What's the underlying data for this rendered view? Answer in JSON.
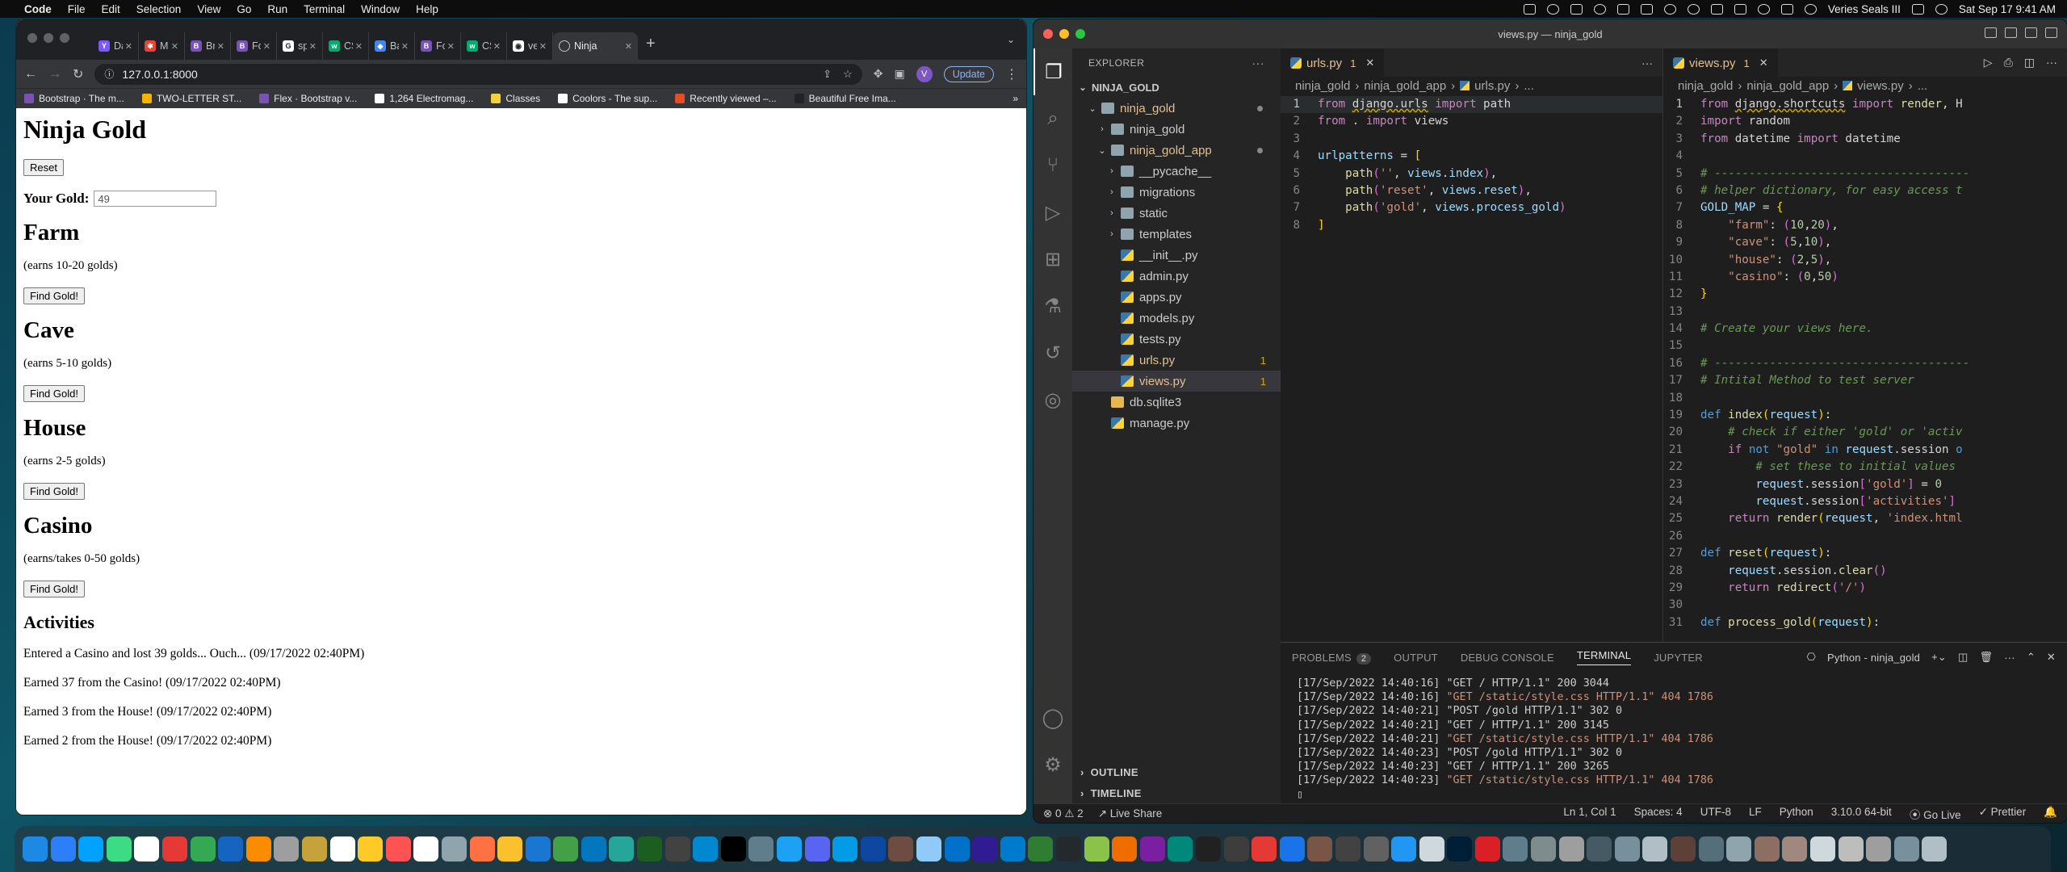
{
  "menubar": {
    "app": "Code",
    "items": [
      "File",
      "Edit",
      "Selection",
      "View",
      "Go",
      "Run",
      "Terminal",
      "Window",
      "Help"
    ],
    "user": "Veries Seals III",
    "clock": "Sat Sep 17  9:41 AM"
  },
  "browser": {
    "tabs": [
      {
        "label": "Day",
        "color": "#7a5af8",
        "glyph": "Y"
      },
      {
        "label": "Mag",
        "color": "#ea4335",
        "glyph": "✱"
      },
      {
        "label": "Brea",
        "color": "#7952b3",
        "glyph": "B"
      },
      {
        "label": "Form",
        "color": "#7952b3",
        "glyph": "B"
      },
      {
        "label": "spar",
        "color": "#ffffff",
        "glyph": "G"
      },
      {
        "label": "CSS",
        "color": "#04aa6d",
        "glyph": "w"
      },
      {
        "label": "Barl",
        "color": "#4285f4",
        "glyph": "◆"
      },
      {
        "label": "Form",
        "color": "#7952b3",
        "glyph": "B"
      },
      {
        "label": "CSS",
        "color": "#04aa6d",
        "glyph": "w"
      },
      {
        "label": "verie",
        "color": "#ffffff",
        "glyph": "◉"
      }
    ],
    "active_tab": "Ninja",
    "url": "127.0.0.1:8000",
    "update_label": "Update",
    "avatar_letter": "V",
    "bookmarks": [
      {
        "label": "Bootstrap · The m...",
        "color": "#7952b3"
      },
      {
        "label": "TWO-LETTER ST...",
        "color": "#f4b400"
      },
      {
        "label": "Flex · Bootstrap v...",
        "color": "#7952b3"
      },
      {
        "label": "1,264 Electromag...",
        "color": "#ffffff"
      },
      {
        "label": "Classes",
        "color": "#f4d03f"
      },
      {
        "label": "Coolors - The sup...",
        "color": "#ffffff"
      },
      {
        "label": "Recently viewed –...",
        "color": "#e44d26"
      },
      {
        "label": "Beautiful Free Ima...",
        "color": "#222222"
      }
    ],
    "more_bookmarks": "»"
  },
  "page": {
    "title": "Ninja Gold",
    "reset_label": "Reset",
    "gold_label": "Your Gold:",
    "gold_value": "49",
    "locations": [
      {
        "name": "Farm",
        "desc": "(earns 10-20 golds)",
        "button": "Find Gold!"
      },
      {
        "name": "Cave",
        "desc": "(earns 5-10 golds)",
        "button": "Find Gold!"
      },
      {
        "name": "House",
        "desc": "(earns 2-5 golds)",
        "button": "Find Gold!"
      },
      {
        "name": "Casino",
        "desc": "(earns/takes 0-50 golds)",
        "button": "Find Gold!"
      }
    ],
    "activities_title": "Activities",
    "activities": [
      "Entered a Casino and lost 39 golds... Ouch... (09/17/2022 02:40PM)",
      "Earned 37 from the Casino! (09/17/2022 02:40PM)",
      "Earned 3 from the House! (09/17/2022 02:40PM)",
      "Earned 2 from the House! (09/17/2022 02:40PM)"
    ]
  },
  "vscode": {
    "title": "views.py — ninja_gold",
    "explorer_title": "EXPLORER",
    "root": "NINJA_GOLD",
    "tree": [
      {
        "label": "ninja_gold",
        "type": "folder",
        "open": true,
        "depth": 1,
        "yellow": true,
        "dot": true
      },
      {
        "label": "ninja_gold",
        "type": "folder",
        "open": false,
        "depth": 2
      },
      {
        "label": "ninja_gold_app",
        "type": "folder",
        "open": true,
        "depth": 2,
        "yellow": true,
        "dot": true
      },
      {
        "label": "__pycache__",
        "type": "folder",
        "open": false,
        "depth": 3
      },
      {
        "label": "migrations",
        "type": "folder",
        "open": false,
        "depth": 3
      },
      {
        "label": "static",
        "type": "folder",
        "open": false,
        "depth": 3
      },
      {
        "label": "templates",
        "type": "folder",
        "open": false,
        "depth": 3
      },
      {
        "label": "__init__.py",
        "type": "py",
        "depth": 3
      },
      {
        "label": "admin.py",
        "type": "py",
        "depth": 3
      },
      {
        "label": "apps.py",
        "type": "py",
        "depth": 3
      },
      {
        "label": "models.py",
        "type": "py",
        "depth": 3
      },
      {
        "label": "tests.py",
        "type": "py",
        "depth": 3
      },
      {
        "label": "urls.py",
        "type": "py",
        "depth": 3,
        "yellow": true,
        "badge": "1"
      },
      {
        "label": "views.py",
        "type": "py",
        "depth": 3,
        "yellow": true,
        "badge": "1",
        "selected": true
      },
      {
        "label": "db.sqlite3",
        "type": "db",
        "depth": 2
      },
      {
        "label": "manage.py",
        "type": "py",
        "depth": 2
      }
    ],
    "outline": "OUTLINE",
    "timeline": "TIMELINE",
    "left_tab": {
      "name": "urls.py",
      "count": "1"
    },
    "right_tab": {
      "name": "views.py",
      "count": "1"
    },
    "left_crumbs": [
      "ninja_gold",
      "ninja_gold_app",
      "urls.py",
      "..."
    ],
    "right_crumbs": [
      "ninja_gold",
      "ninja_gold_app",
      "views.py",
      "..."
    ],
    "panel_tabs": [
      "PROBLEMS",
      "OUTPUT",
      "DEBUG CONSOLE",
      "TERMINAL",
      "JUPYTER"
    ],
    "problems_count": "2",
    "terminal_name": "Python - ninja_gold",
    "terminal_lines": [
      {
        "p": "[17/Sep/2022 14:40:16] ",
        "s": "\"GET / HTTP/1.1\" 200 3044",
        "err": false
      },
      {
        "p": "[17/Sep/2022 14:40:16] ",
        "s": "\"GET /static/style.css HTTP/1.1\" 404 1786",
        "err": true
      },
      {
        "p": "[17/Sep/2022 14:40:21] ",
        "s": "\"POST /gold HTTP/1.1\" 302 0",
        "err": false
      },
      {
        "p": "[17/Sep/2022 14:40:21] ",
        "s": "\"GET / HTTP/1.1\" 200 3145",
        "err": false
      },
      {
        "p": "[17/Sep/2022 14:40:21] ",
        "s": "\"GET /static/style.css HTTP/1.1\" 404 1786",
        "err": true
      },
      {
        "p": "[17/Sep/2022 14:40:23] ",
        "s": "\"POST /gold HTTP/1.1\" 302 0",
        "err": false
      },
      {
        "p": "[17/Sep/2022 14:40:23] ",
        "s": "\"GET / HTTP/1.1\" 200 3265",
        "err": false
      },
      {
        "p": "[17/Sep/2022 14:40:23] ",
        "s": "\"GET /static/style.css HTTP/1.1\" 404 1786",
        "err": true
      }
    ],
    "status": {
      "errors": "⊗ 0 ⚠ 2",
      "live_share": "Live Share",
      "position": "Ln 1, Col 1",
      "spaces": "Spaces: 4",
      "encoding": "UTF-8",
      "eol": "LF",
      "language": "Python",
      "interpreter": "3.10.0 64-bit",
      "go_live": "Go Live",
      "prettier": "Prettier"
    }
  },
  "colors": {
    "vscode_bg": "#1e1e1e",
    "chrome_dark": "#202124",
    "modified": "#e2c08d",
    "keyword": "#c586c0",
    "string": "#ce9178",
    "comment": "#6a9955"
  }
}
